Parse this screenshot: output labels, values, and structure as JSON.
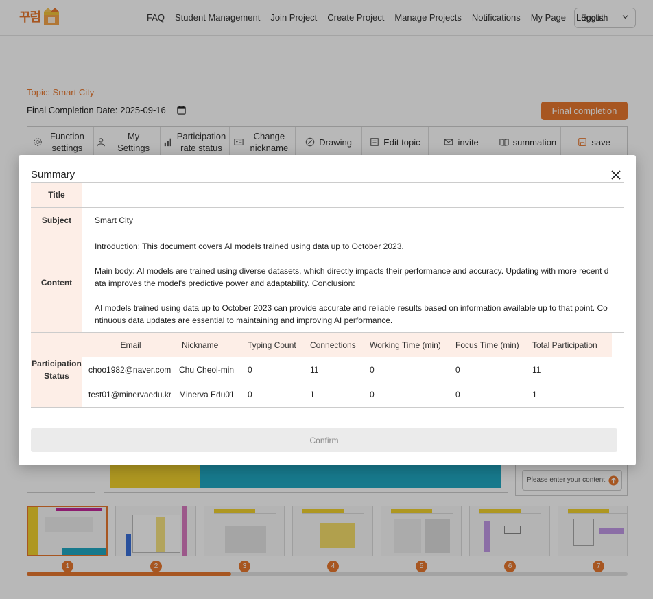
{
  "app": {
    "logo_text": "꾸럼",
    "language": "English"
  },
  "nav": {
    "items": [
      "FAQ",
      "Student Management",
      "Join Project",
      "Create Project",
      "Manage Projects",
      "Notifications",
      "My Page",
      "Logout"
    ]
  },
  "project": {
    "topic_label": "Topic: Smart City",
    "final_date_label": "Final Completion Date:",
    "final_date_value": "2025-09-16",
    "final_button": "Final completion"
  },
  "toolbar": {
    "items": [
      {
        "label": "Function settings",
        "icon": "gear-icon"
      },
      {
        "label": "My Settings",
        "icon": "user-settings-icon"
      },
      {
        "label": "Participation rate status",
        "icon": "bar-chart-icon"
      },
      {
        "label": "Change nickname",
        "icon": "id-card-icon"
      },
      {
        "label": "Drawing",
        "icon": "pencil-circle-icon"
      },
      {
        "label": "Edit topic",
        "icon": "document-icon"
      },
      {
        "label": "invite",
        "icon": "mail-icon"
      },
      {
        "label": "summation",
        "icon": "book-icon"
      },
      {
        "label": "save",
        "icon": "save-icon"
      }
    ]
  },
  "chat": {
    "placeholder": "Please enter your content."
  },
  "thumbnails": {
    "numbers": [
      "1",
      "2",
      "3",
      "4",
      "5",
      "6",
      "7"
    ],
    "progress": 0.34
  },
  "modal": {
    "title": "Summary",
    "labels": {
      "title": "Title",
      "subject": "Subject",
      "content": "Content",
      "participation": "Participation Status"
    },
    "title_value": "",
    "subject_value": "Smart City",
    "content_value": "Introduction: This document covers AI models trained using data up to October 2023.\n\nMain body: AI models are trained using diverse datasets, which directly impacts their performance and accuracy. Updating with more recent data improves the model's predictive power and adaptability. Conclusion:\n\nAI models trained using data up to October 2023 can provide accurate and reliable results based on information available up to that point. Continuous data updates are essential to maintaining and improving AI performance.",
    "participation": {
      "headers": [
        "Email",
        "Nickname",
        "Typing Count",
        "Connections",
        "Working Time (min)",
        "Focus Time (min)",
        "Total Participation"
      ],
      "rows": [
        [
          "choo1982@naver.com",
          "Chu Cheol-min",
          "0",
          "11",
          "0",
          "0",
          "11"
        ],
        [
          "test01@minervaedu.kr",
          "Minerva Edu01",
          "0",
          "1",
          "0",
          "0",
          "1"
        ]
      ]
    },
    "confirm_label": "Confirm"
  }
}
